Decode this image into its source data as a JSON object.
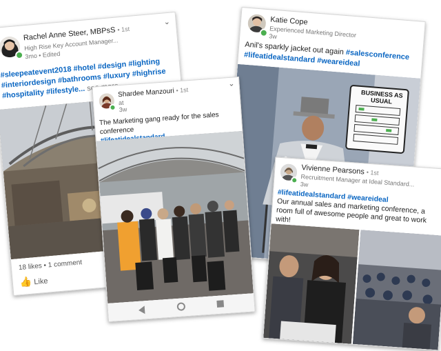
{
  "post1": {
    "author": "Rachel Anne Steer, MBPsS",
    "degree": "• 1st",
    "headline": "High Rise Key Account Manager...",
    "meta": "3mo • Edited",
    "hashtags": "#sleepeatevent2018 #hotel #design #lighting #interiordesign #bathrooms #luxury #highrise #hospitality #lifestyle...",
    "see_more": "see more",
    "reactions": "18 likes • 1 comment",
    "like_label": "Like"
  },
  "post2": {
    "author": "Shardee Manzouri",
    "degree": "• 1st",
    "meta_line1": "at",
    "meta_line2": "3w",
    "text": "The Marketing gang ready for the sales conference",
    "hashtag": "#lifeatidealstandard"
  },
  "post3": {
    "author": "Katie Cope",
    "headline": "Experienced Marketing Director",
    "meta": "3w",
    "text": "Anil's sparkly jacket out again ",
    "hashtags": "#salesconference #lifeatidealstandard #weareideal",
    "sign_text": "BUSINESS AS USUAL"
  },
  "post4": {
    "author": "Vivienne Pearsons",
    "degree": "• 1st",
    "headline": "Recruitment Manager at Ideal Standard...",
    "meta": "3w",
    "hashtags": "#lifeatidealstandard #weareideal",
    "text": "Our annual sales and marketing conference, a room full of awesome people and great to work with!"
  },
  "icons": {
    "chevron": "chevron-down-icon",
    "like": "thumbs-up-icon",
    "comment": "comment-icon",
    "nav_back": "back-triangle-icon",
    "nav_home": "home-circle-icon",
    "nav_recent": "recent-square-icon"
  },
  "colors": {
    "hashtag": "#0a66c2",
    "online": "#4caf50"
  }
}
